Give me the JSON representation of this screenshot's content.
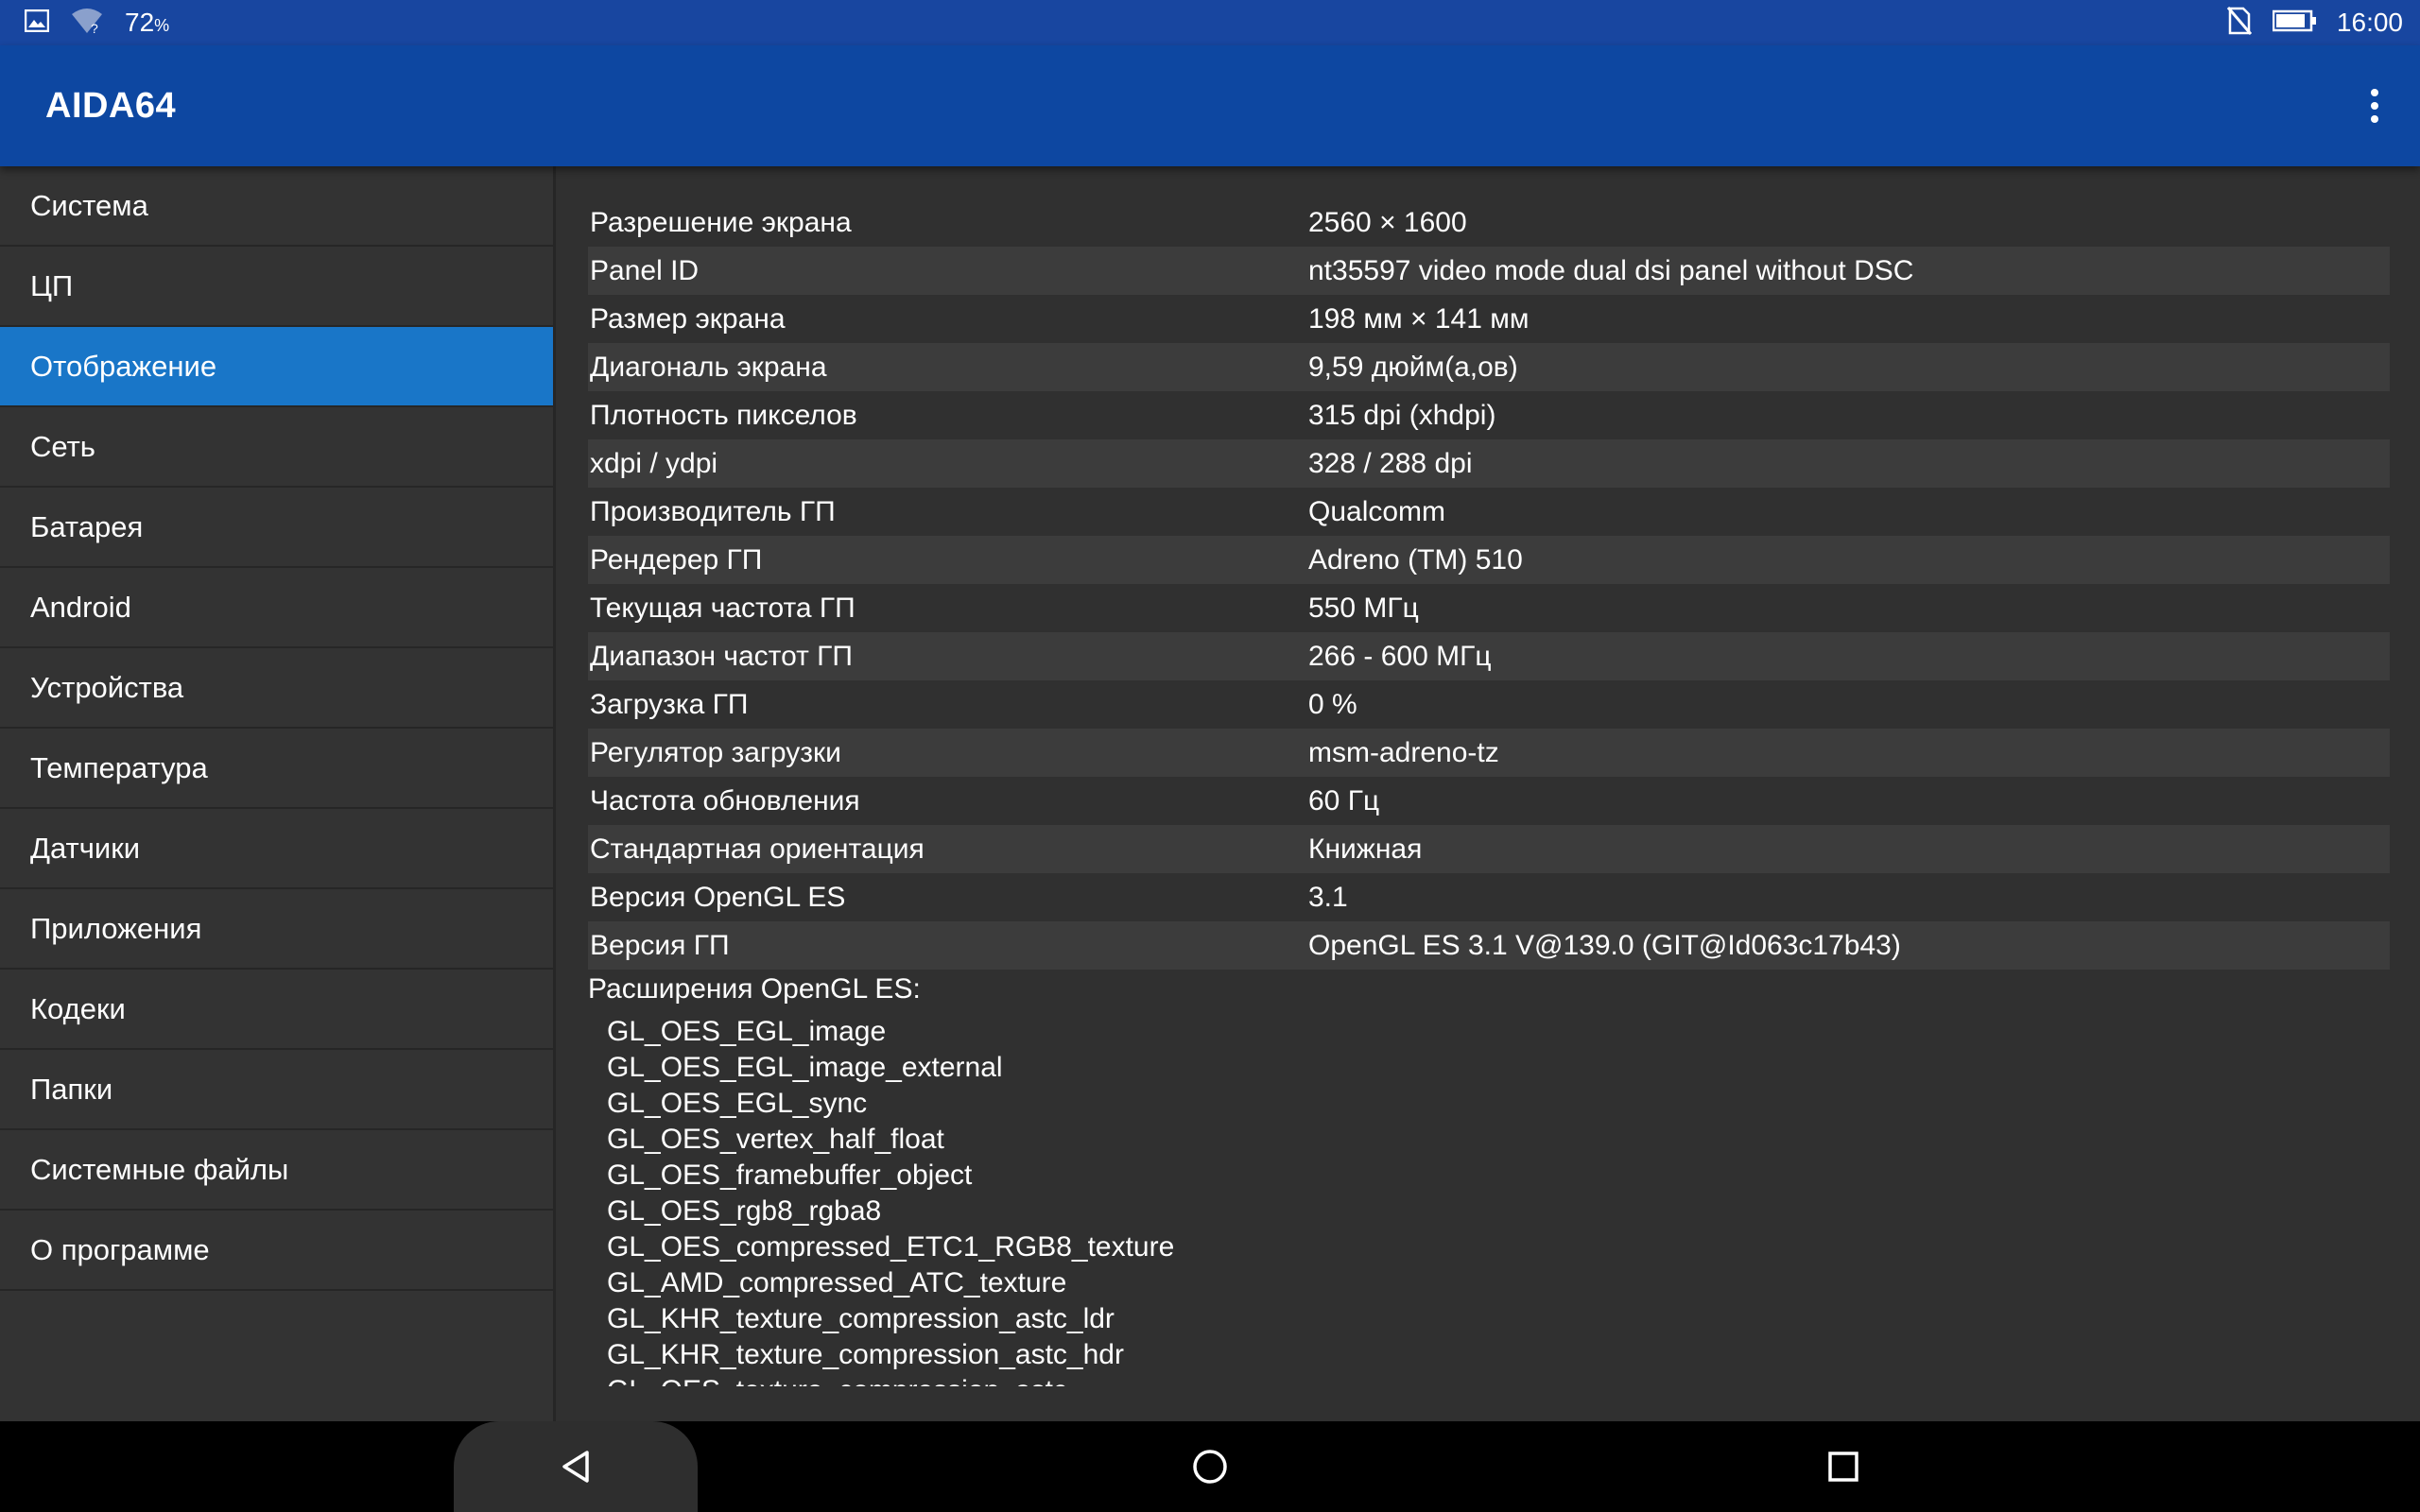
{
  "status_bar": {
    "battery_percent_left": "72",
    "battery_percent_left_suffix": "%",
    "time": "16:00",
    "icons_left": [
      "image-icon",
      "wifi-icon"
    ],
    "icons_right": [
      "no-sim-icon",
      "battery-icon"
    ]
  },
  "app_bar": {
    "title": "AIDA64",
    "menu_icon": "more-vert-icon"
  },
  "sidebar": {
    "items": [
      {
        "label": "Система"
      },
      {
        "label": "ЦП"
      },
      {
        "label": "Отображение",
        "active": true
      },
      {
        "label": "Сеть"
      },
      {
        "label": "Батарея"
      },
      {
        "label": "Android"
      },
      {
        "label": "Устройства"
      },
      {
        "label": "Температура"
      },
      {
        "label": "Датчики"
      },
      {
        "label": "Приложения"
      },
      {
        "label": "Кодеки"
      },
      {
        "label": "Папки"
      },
      {
        "label": "Системные файлы"
      },
      {
        "label": "О программе"
      }
    ],
    "accent_color": "#1976c8"
  },
  "display_info": {
    "rows": [
      {
        "key": "Разрешение экрана",
        "value": "2560 × 1600"
      },
      {
        "key": "Panel ID",
        "value": "nt35597 video mode dual dsi panel without DSC"
      },
      {
        "key": "Размер экрана",
        "value": "198 мм × 141 мм"
      },
      {
        "key": "Диагональ экрана",
        "value": "9,59 дюйм(а,ов)"
      },
      {
        "key": "Плотность пикселов",
        "value": "315 dpi (xhdpi)"
      },
      {
        "key": "xdpi / ydpi",
        "value": "328 / 288 dpi"
      },
      {
        "key": "Производитель ГП",
        "value": "Qualcomm"
      },
      {
        "key": "Рендерер ГП",
        "value": "Adreno (TM) 510"
      },
      {
        "key": "Текущая частота ГП",
        "value": "550 МГц"
      },
      {
        "key": "Диапазон частот ГП",
        "value": "266 - 600 МГц"
      },
      {
        "key": "Загрузка ГП",
        "value": "0 %"
      },
      {
        "key": "Регулятор загрузки",
        "value": "msm-adreno-tz"
      },
      {
        "key": "Частота обновления",
        "value": "60 Гц"
      },
      {
        "key": "Стандартная ориентация",
        "value": "Книжная"
      },
      {
        "key": "Версия OpenGL ES",
        "value": "3.1"
      },
      {
        "key": "Версия ГП",
        "value": "OpenGL ES 3.1 V@139.0 (GIT@Id063c17b43)"
      }
    ],
    "extensions_title": "Расширения OpenGL ES:",
    "extensions": [
      "GL_OES_EGL_image",
      "GL_OES_EGL_image_external",
      "GL_OES_EGL_sync",
      "GL_OES_vertex_half_float",
      "GL_OES_framebuffer_object",
      "GL_OES_rgb8_rgba8",
      "GL_OES_compressed_ETC1_RGB8_texture",
      "GL_AMD_compressed_ATC_texture",
      "GL_KHR_texture_compression_astc_ldr",
      "GL_KHR_texture_compression_astc_hdr",
      "GL_OES_texture_compression_astc"
    ]
  },
  "nav_bar": {
    "buttons": [
      "back-icon",
      "home-icon",
      "recents-icon"
    ]
  }
}
